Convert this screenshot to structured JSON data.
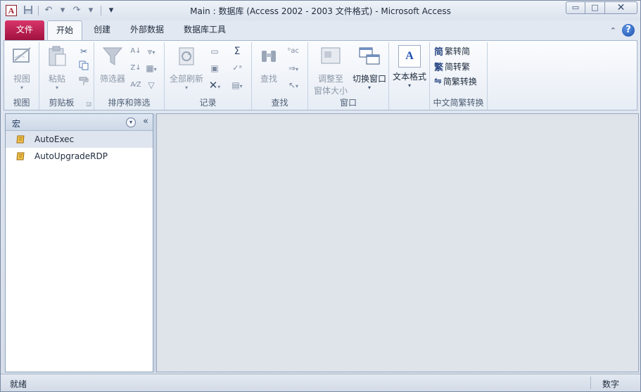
{
  "window": {
    "title": "Main : 数据库 (Access 2002 - 2003 文件格式)  -  Microsoft Access",
    "app_icon": "A",
    "buttons": {
      "minimize": "▭",
      "restore": "□",
      "close": "✕"
    }
  },
  "qat": {
    "save_icon": "save-icon",
    "undo_icon": "undo-icon",
    "redo_icon": "redo-icon",
    "customize_icon": "customize-icon"
  },
  "tabs": {
    "file": "文件",
    "home": "开始",
    "create": "创建",
    "external": "外部数据",
    "dbtools": "数据库工具"
  },
  "ribbon": {
    "groups": {
      "view": {
        "label": "视图",
        "button": "视图"
      },
      "clipboard": {
        "label": "剪贴板",
        "paste": "粘贴"
      },
      "sort": {
        "label": "排序和筛选",
        "filter": "筛选器"
      },
      "records": {
        "label": "记录",
        "refresh": "全部刷新"
      },
      "find": {
        "label": "查找",
        "find": "查找"
      },
      "window": {
        "label": "窗口",
        "fit_line1": "调整至",
        "fit_line2": "窗体大小",
        "switch": "切换窗口"
      },
      "text": {
        "label": "",
        "format": "文本格式"
      },
      "convert": {
        "label": "中文简繁转换",
        "to_simplified": "繁转简",
        "to_traditional": "简转繁",
        "convert": "简繁转换",
        "icon_simplified": "简",
        "icon_traditional": "繁"
      }
    }
  },
  "nav": {
    "title": "宏",
    "collapse": "«",
    "items": [
      {
        "label": "AutoExec",
        "selected": true
      },
      {
        "label": "AutoUpgradeRDP",
        "selected": false
      }
    ]
  },
  "status": {
    "left": "就绪",
    "right": "数字"
  },
  "colors": {
    "file_tab": "#b71b4f",
    "accent": "#1e395b",
    "work_area": "#dfe3ea"
  }
}
